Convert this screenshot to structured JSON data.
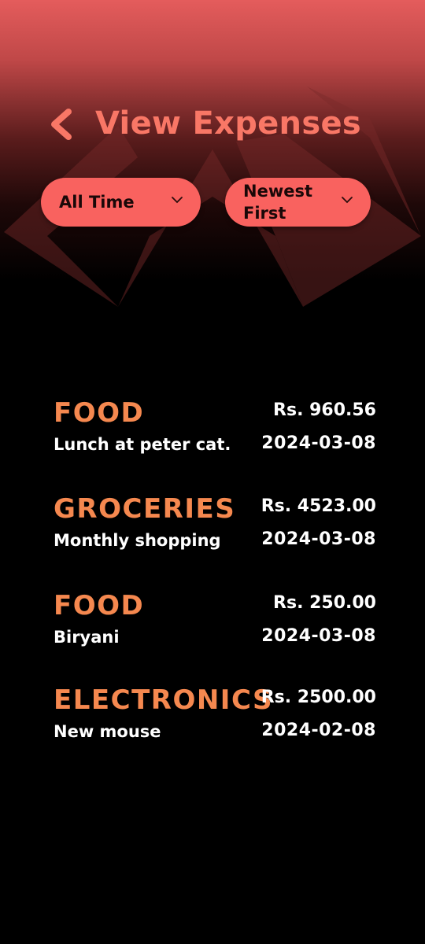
{
  "header": {
    "title": "View Expenses",
    "back_icon": "chevron-left-icon"
  },
  "filters": {
    "range": {
      "selected": "All Time",
      "icon": "chevron-down-icon"
    },
    "sort": {
      "selected": "Newest First",
      "icon": "chevron-down-icon"
    }
  },
  "expenses": [
    {
      "category": "FOOD",
      "description": "Lunch at peter cat.",
      "amount": "Rs. 960.56",
      "date": "2024-03-08"
    },
    {
      "category": "GROCERIES",
      "description": "Monthly shopping",
      "amount": "Rs. 4523.00",
      "date": "2024-03-08"
    },
    {
      "category": "FOOD",
      "description": "Biryani",
      "amount": "Rs. 250.00",
      "date": "2024-03-08"
    },
    {
      "category": "ELECTRONICS",
      "description": "New mouse",
      "amount": "Rs. 2500.00",
      "date": "2024-02-08"
    }
  ],
  "colors": {
    "accent": "#f9625f",
    "title": "#f97766",
    "category": "#f5884f",
    "background": "#000000"
  }
}
